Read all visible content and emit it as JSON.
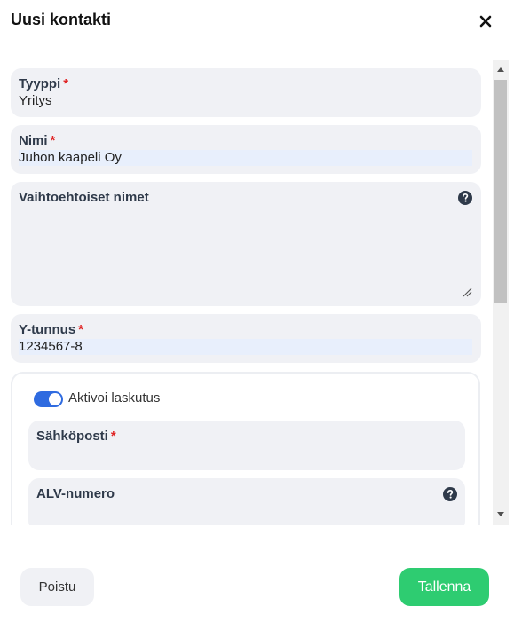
{
  "dialog": {
    "title": "Uusi kontakti",
    "close_icon": "close-icon"
  },
  "form": {
    "type": {
      "label": "Tyyppi",
      "required_mark": "*",
      "value": "Yritys"
    },
    "name": {
      "label": "Nimi",
      "required_mark": "*",
      "value": "Juhon kaapeli Oy"
    },
    "alt_names": {
      "label": "Vaihtoehtoiset nimet",
      "value": "",
      "help_icon": "question-circle-icon"
    },
    "business_id": {
      "label": "Y-tunnus",
      "required_mark": "*",
      "value": "1234567-8"
    },
    "billing": {
      "toggle_label": "Aktivoi laskutus",
      "toggle_on": true,
      "email": {
        "label": "Sähköposti",
        "required_mark": "*",
        "value": ""
      },
      "vat_number": {
        "label": "ALV-numero",
        "value": "",
        "help_icon": "question-circle-icon"
      }
    }
  },
  "footer": {
    "delete_label": "Poistu",
    "save_label": "Tallenna"
  },
  "colors": {
    "accent_blue": "#2f6be0",
    "save_green": "#2ecc71",
    "required_red": "#e02424",
    "field_bg": "#f0f1f5"
  }
}
